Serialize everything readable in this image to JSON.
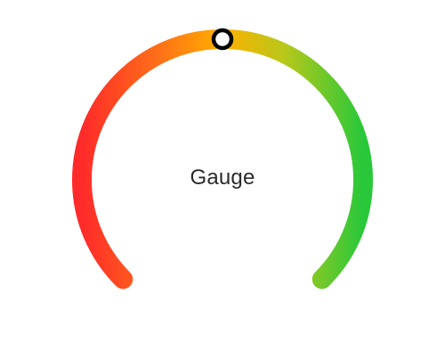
{
  "gauge": {
    "label": "Gauge",
    "value": 0.5,
    "colors": {
      "low": "#ff2a2a",
      "low_mid": "#ff6a1a",
      "mid": "#ffb000",
      "mid_high": "#b8c81a",
      "high": "#28c83a",
      "handle_border": "#000000",
      "handle_fill": "#ffffff",
      "label_text": "#2b2b2b"
    }
  }
}
